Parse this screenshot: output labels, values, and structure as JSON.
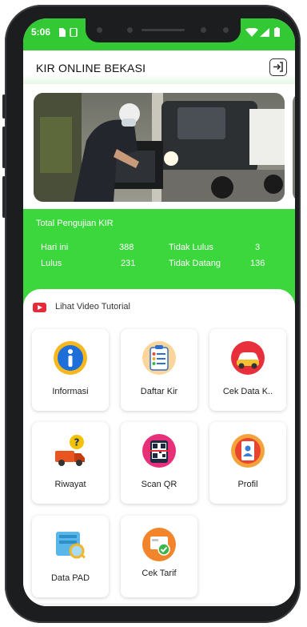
{
  "status_bar": {
    "time": "5:06"
  },
  "app_bar": {
    "title": "KIR ONLINE BEKASI",
    "action_icon": "logout-icon"
  },
  "stats": {
    "title": "Total Pengujian KIR",
    "hari_ini_label": "Hari ini",
    "hari_ini_value": "388",
    "tidak_lulus_label": "Tidak Lulus",
    "tidak_lulus_value": "3",
    "lulus_label": "Lulus",
    "lulus_value": "231",
    "tidak_datang_label": "Tidak Datang",
    "tidak_datang_value": "136"
  },
  "tutorial": {
    "label": "Lihat Video Tutorial",
    "icon": "youtube-play-icon"
  },
  "menu": [
    {
      "label": "Informasi",
      "icon": "info-icon"
    },
    {
      "label": "Daftar Kir",
      "icon": "clipboard-list-icon"
    },
    {
      "label": "Cek Data K..",
      "icon": "car-icon"
    },
    {
      "label": "Riwayat",
      "icon": "truck-question-icon"
    },
    {
      "label": "Scan QR",
      "icon": "qr-code-icon"
    },
    {
      "label": "Profil",
      "icon": "profile-card-icon"
    },
    {
      "label": "Data PAD",
      "icon": "data-search-icon"
    },
    {
      "label": "Cek Tarif",
      "icon": "tariff-check-icon"
    }
  ],
  "colors": {
    "primary_green": "#3cd63d",
    "status_green": "#32c934",
    "accent_red": "#e52a3a"
  }
}
